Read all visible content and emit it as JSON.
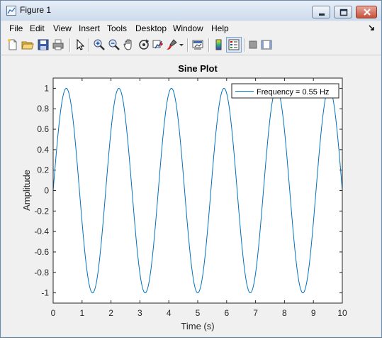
{
  "window": {
    "title": "Figure 1"
  },
  "menu": [
    "File",
    "Edit",
    "View",
    "Insert",
    "Tools",
    "Desktop",
    "Window",
    "Help"
  ],
  "toolbar_icons": [
    "new-figure-icon",
    "open-file-icon",
    "save-icon",
    "print-icon",
    "edit-plot-icon",
    "zoom-in-icon",
    "zoom-out-icon",
    "pan-icon",
    "rotate-3d-icon",
    "data-cursor-icon",
    "brush-icon",
    "brush-dropdown-icon",
    "link-plot-icon",
    "insert-colorbar-icon",
    "insert-legend-icon",
    "hide-plot-tools-icon",
    "show-plot-tools-icon"
  ],
  "chart_data": {
    "type": "line",
    "title": "Sine Plot",
    "xlabel": "Time (s)",
    "ylabel": "Amplitude",
    "xlim": [
      0,
      10
    ],
    "ylim": [
      -1.1,
      1.1
    ],
    "xticks": [
      "0",
      "1",
      "2",
      "3",
      "4",
      "5",
      "6",
      "7",
      "8",
      "9",
      "10"
    ],
    "yticks": [
      "1",
      "0.8",
      "0.6",
      "0.4",
      "0.2",
      "0",
      "-0.2",
      "-0.4",
      "-0.6",
      "-0.8",
      "-1"
    ],
    "series": [
      {
        "name": "Frequency = 0.55 Hz",
        "function": "sin(2*pi*0.55*t)",
        "frequency_hz": 0.55,
        "amplitude": 1,
        "color": "#0072bd"
      }
    ],
    "legend": "top-right",
    "grid": false
  }
}
